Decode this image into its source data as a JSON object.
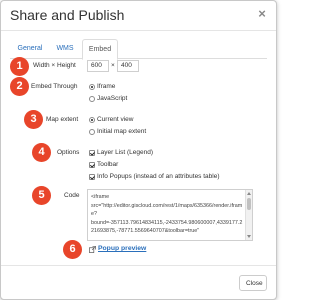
{
  "dialog": {
    "title": "Share and Publish",
    "close_glyph": "×"
  },
  "tabs": [
    {
      "label": "General",
      "active": false
    },
    {
      "label": "WMS",
      "active": false
    },
    {
      "label": "Embed",
      "active": true
    }
  ],
  "badges": [
    "1",
    "2",
    "3",
    "4",
    "5",
    "6"
  ],
  "size": {
    "label": "Width × Height",
    "width": "600",
    "separator": "×",
    "height": "400"
  },
  "embed_through": {
    "label": "Embed Through",
    "options": [
      {
        "label": "Iframe",
        "selected": true
      },
      {
        "label": "JavaScript",
        "selected": false
      }
    ]
  },
  "map_extent": {
    "label": "Map extent",
    "options": [
      {
        "label": "Current view",
        "selected": true
      },
      {
        "label": "Initial map extent",
        "selected": false
      }
    ]
  },
  "options": {
    "label": "Options",
    "items": [
      {
        "label": "Layer List (Legend)",
        "checked": true
      },
      {
        "label": "Toolbar",
        "checked": true
      },
      {
        "label": "Info Popups (instead of an attributes table)",
        "checked": true
      }
    ]
  },
  "code": {
    "label": "Code",
    "value": "<iframe\nsrc=\"http://editor.giscloud.com/rest/1/maps/635366/render.iframe?\nbound=-357113.79614834115,-2433754.980600007,4339177.221693875,-78771.5569640707&toolbar=true\""
  },
  "popup_preview": {
    "label": "Popup preview"
  },
  "footer": {
    "close_label": "Close"
  },
  "colors": {
    "badge": "#e8452a",
    "link": "#2a6fbb"
  }
}
